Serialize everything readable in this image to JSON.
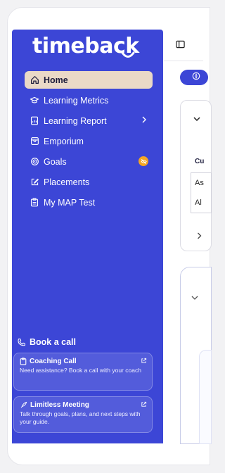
{
  "brand": {
    "logo_text": "timeback",
    "color": "#3c46d6"
  },
  "sidebar": {
    "items": [
      {
        "label": "Home",
        "icon": "home-icon",
        "active": true
      },
      {
        "label": "Learning Metrics",
        "icon": "graduation-cap-icon"
      },
      {
        "label": "Learning Report",
        "icon": "report-icon",
        "has_submenu": true
      },
      {
        "label": "Emporium",
        "icon": "store-icon"
      },
      {
        "label": "Goals",
        "icon": "target-icon",
        "badge_icon": "eye-off-icon"
      },
      {
        "label": "Placements",
        "icon": "edit-icon"
      },
      {
        "label": "My MAP Test",
        "icon": "clipboard-icon"
      }
    ],
    "book_call": {
      "heading": "Book a call",
      "cards": [
        {
          "title": "Coaching Call",
          "description": "Need assistance? Book a call with your coach",
          "icon": "clipboard-icon"
        },
        {
          "title": "Limitless Meeting",
          "description": "Talk through goals, plans, and next steps with your guide.",
          "icon": "rocket-icon"
        }
      ]
    }
  },
  "main": {
    "section_label": "Cu",
    "row_values": [
      "As",
      "Al"
    ]
  }
}
